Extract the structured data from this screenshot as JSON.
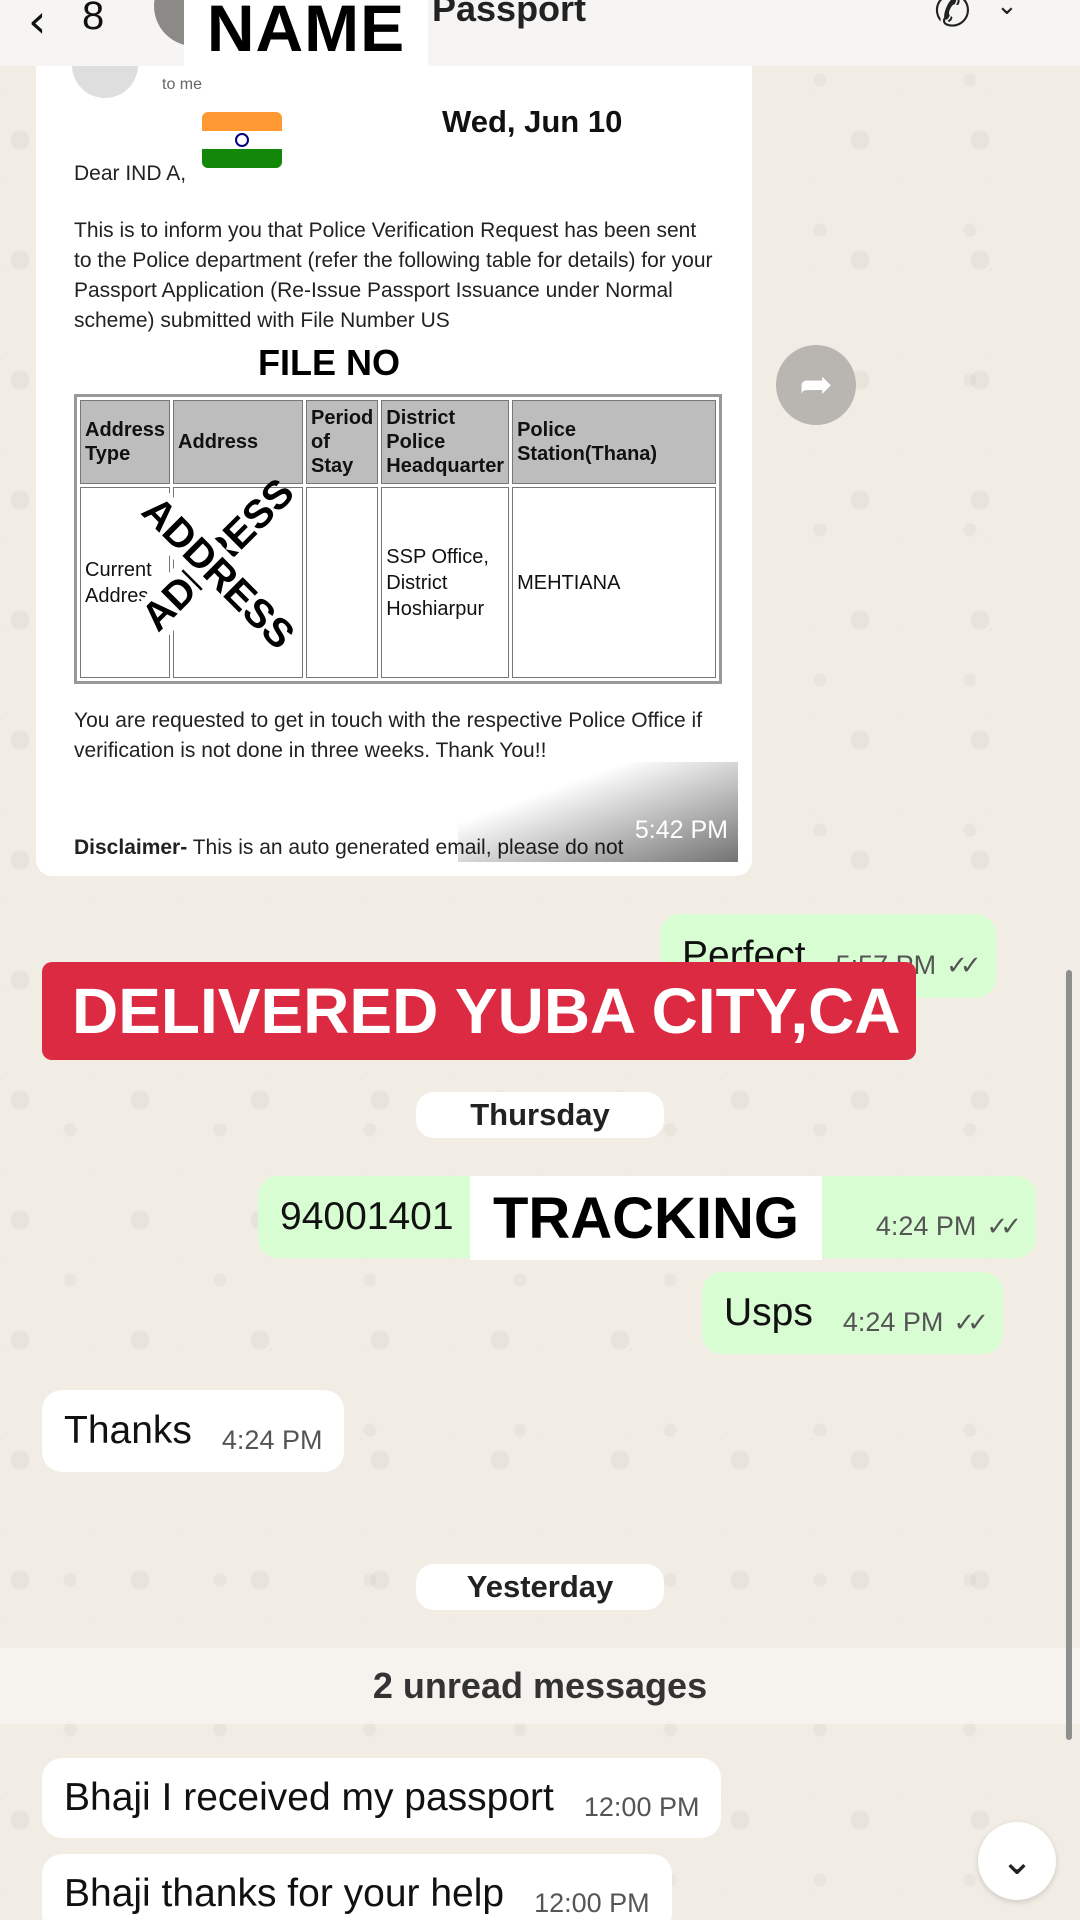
{
  "header": {
    "back_count": "8",
    "title": "t Passport"
  },
  "overlays": {
    "name": "NAME",
    "file_no": "FILE NO",
    "address": "ADDRESS",
    "banner": "DELIVERED YUBA CITY,CA",
    "tracking": "TRACKING"
  },
  "email": {
    "to": "to me",
    "date": "Wed, Jun 10",
    "salutation": "Dear IND                        A,",
    "paragraph1": "This is to inform you that Police Verification Request has been sent to the Police department (refer the following table for details) for your Passport Application (Re-Issue Passport Issuance under Normal scheme) submitted with File Number US",
    "table": {
      "headers": [
        "Address Type",
        "Address",
        "Period of Stay",
        "District Police Headquarter",
        "Police Station(Thana)"
      ],
      "row": [
        "Current Address",
        "",
        "",
        "SSP Office, District Hoshiarpur",
        "MEHTIANA"
      ]
    },
    "paragraph2": "You are requested to get in touch with the respective Police Office if verification is not done in three weeks. Thank You!!",
    "disclaimer_label": "Disclaimer-",
    "disclaimer_text": "This is an auto generated email, please do not"
  },
  "separators": {
    "thursday": "Thursday",
    "yesterday": "Yesterday",
    "unread": "2 unread messages"
  },
  "messages": {
    "image_time": "5:42 PM",
    "perfect": {
      "text": "Perfect",
      "time": "5:57 PM"
    },
    "tracking": {
      "text": "94001401",
      "time": "4:24 PM"
    },
    "usps": {
      "text": "Usps",
      "time": "4:24 PM"
    },
    "thanks": {
      "text": "Thanks",
      "time": "4:24 PM"
    },
    "received": {
      "text": "Bhaji I received my passport",
      "time": "12:00 PM"
    },
    "help": {
      "text": "Bhaji thanks for your help",
      "time": "12:00 PM"
    }
  },
  "colors": {
    "outgoing_bubble": "#d9fdd3",
    "incoming_bubble": "#ffffff",
    "banner": "#dc2a42",
    "wallpaper": "#efeae2"
  }
}
